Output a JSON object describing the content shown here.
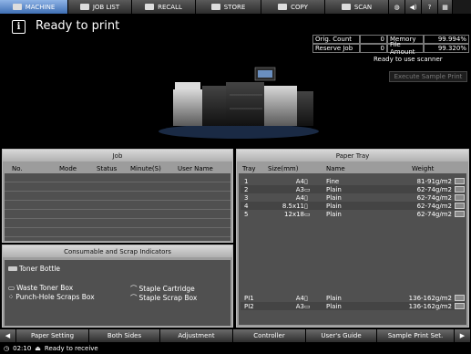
{
  "tabs": [
    {
      "label": "MACHINE",
      "icon": "printer-icon",
      "active": true
    },
    {
      "label": "JOB LIST",
      "icon": "list-icon",
      "active": false
    },
    {
      "label": "RECALL",
      "icon": "recall-icon",
      "active": false
    },
    {
      "label": "STORE",
      "icon": "store-icon",
      "active": false
    },
    {
      "label": "COPY",
      "icon": "copy-icon",
      "active": false
    },
    {
      "label": "SCAN",
      "icon": "scan-icon",
      "active": false
    }
  ],
  "status": {
    "text": "Ready to print"
  },
  "counters": {
    "orig_count_label": "Orig. Count",
    "orig_count_value": "0",
    "memory_label": "Memory",
    "memory_value": "99.994%",
    "reserve_job_label": "Reserve Job",
    "reserve_job_value": "0",
    "file_amount_label": "File Amount",
    "file_amount_value": "99.320%"
  },
  "scanner_msg": "Ready to use scanner",
  "sample_print_label": "Execute Sample Print",
  "job": {
    "title": "Job",
    "headers": [
      "No.",
      "Mode",
      "Status",
      "Minute(S)",
      "User Name"
    ]
  },
  "consumables": {
    "title": "Consumable and Scrap Indicators",
    "items": [
      "Toner Bottle",
      "Waste Toner Box",
      "Punch-Hole Scraps Box",
      "Staple Cartridge",
      "Staple Scrap Box"
    ]
  },
  "paper_tray": {
    "title": "Paper Tray",
    "headers": [
      "Tray",
      "Size(mm)",
      "Name",
      "Weight"
    ],
    "rows": [
      {
        "tray": "1",
        "size": "A4",
        "name": "Fine",
        "weight": "81-91g/m2"
      },
      {
        "tray": "2",
        "size": "A3",
        "name": "Plain",
        "weight": "62-74g/m2"
      },
      {
        "tray": "3",
        "size": "A4",
        "name": "Plain",
        "weight": "62-74g/m2"
      },
      {
        "tray": "4",
        "size": "8.5x11",
        "name": "Plain",
        "weight": "62-74g/m2"
      },
      {
        "tray": "5",
        "size": "12x18",
        "name": "Plain",
        "weight": "62-74g/m2"
      }
    ],
    "pi_rows": [
      {
        "tray": "PI1",
        "size": "A4",
        "name": "Plain",
        "weight": "136-162g/m2"
      },
      {
        "tray": "PI2",
        "size": "A3",
        "name": "Plain",
        "weight": "136-162g/m2"
      }
    ]
  },
  "bottom_buttons": [
    "Paper Setting",
    "Both Sides",
    "Adjustment",
    "Controller",
    "User's Guide",
    "Sample Print Set."
  ],
  "footer": {
    "time": "02:10",
    "message": "Ready to receive"
  }
}
